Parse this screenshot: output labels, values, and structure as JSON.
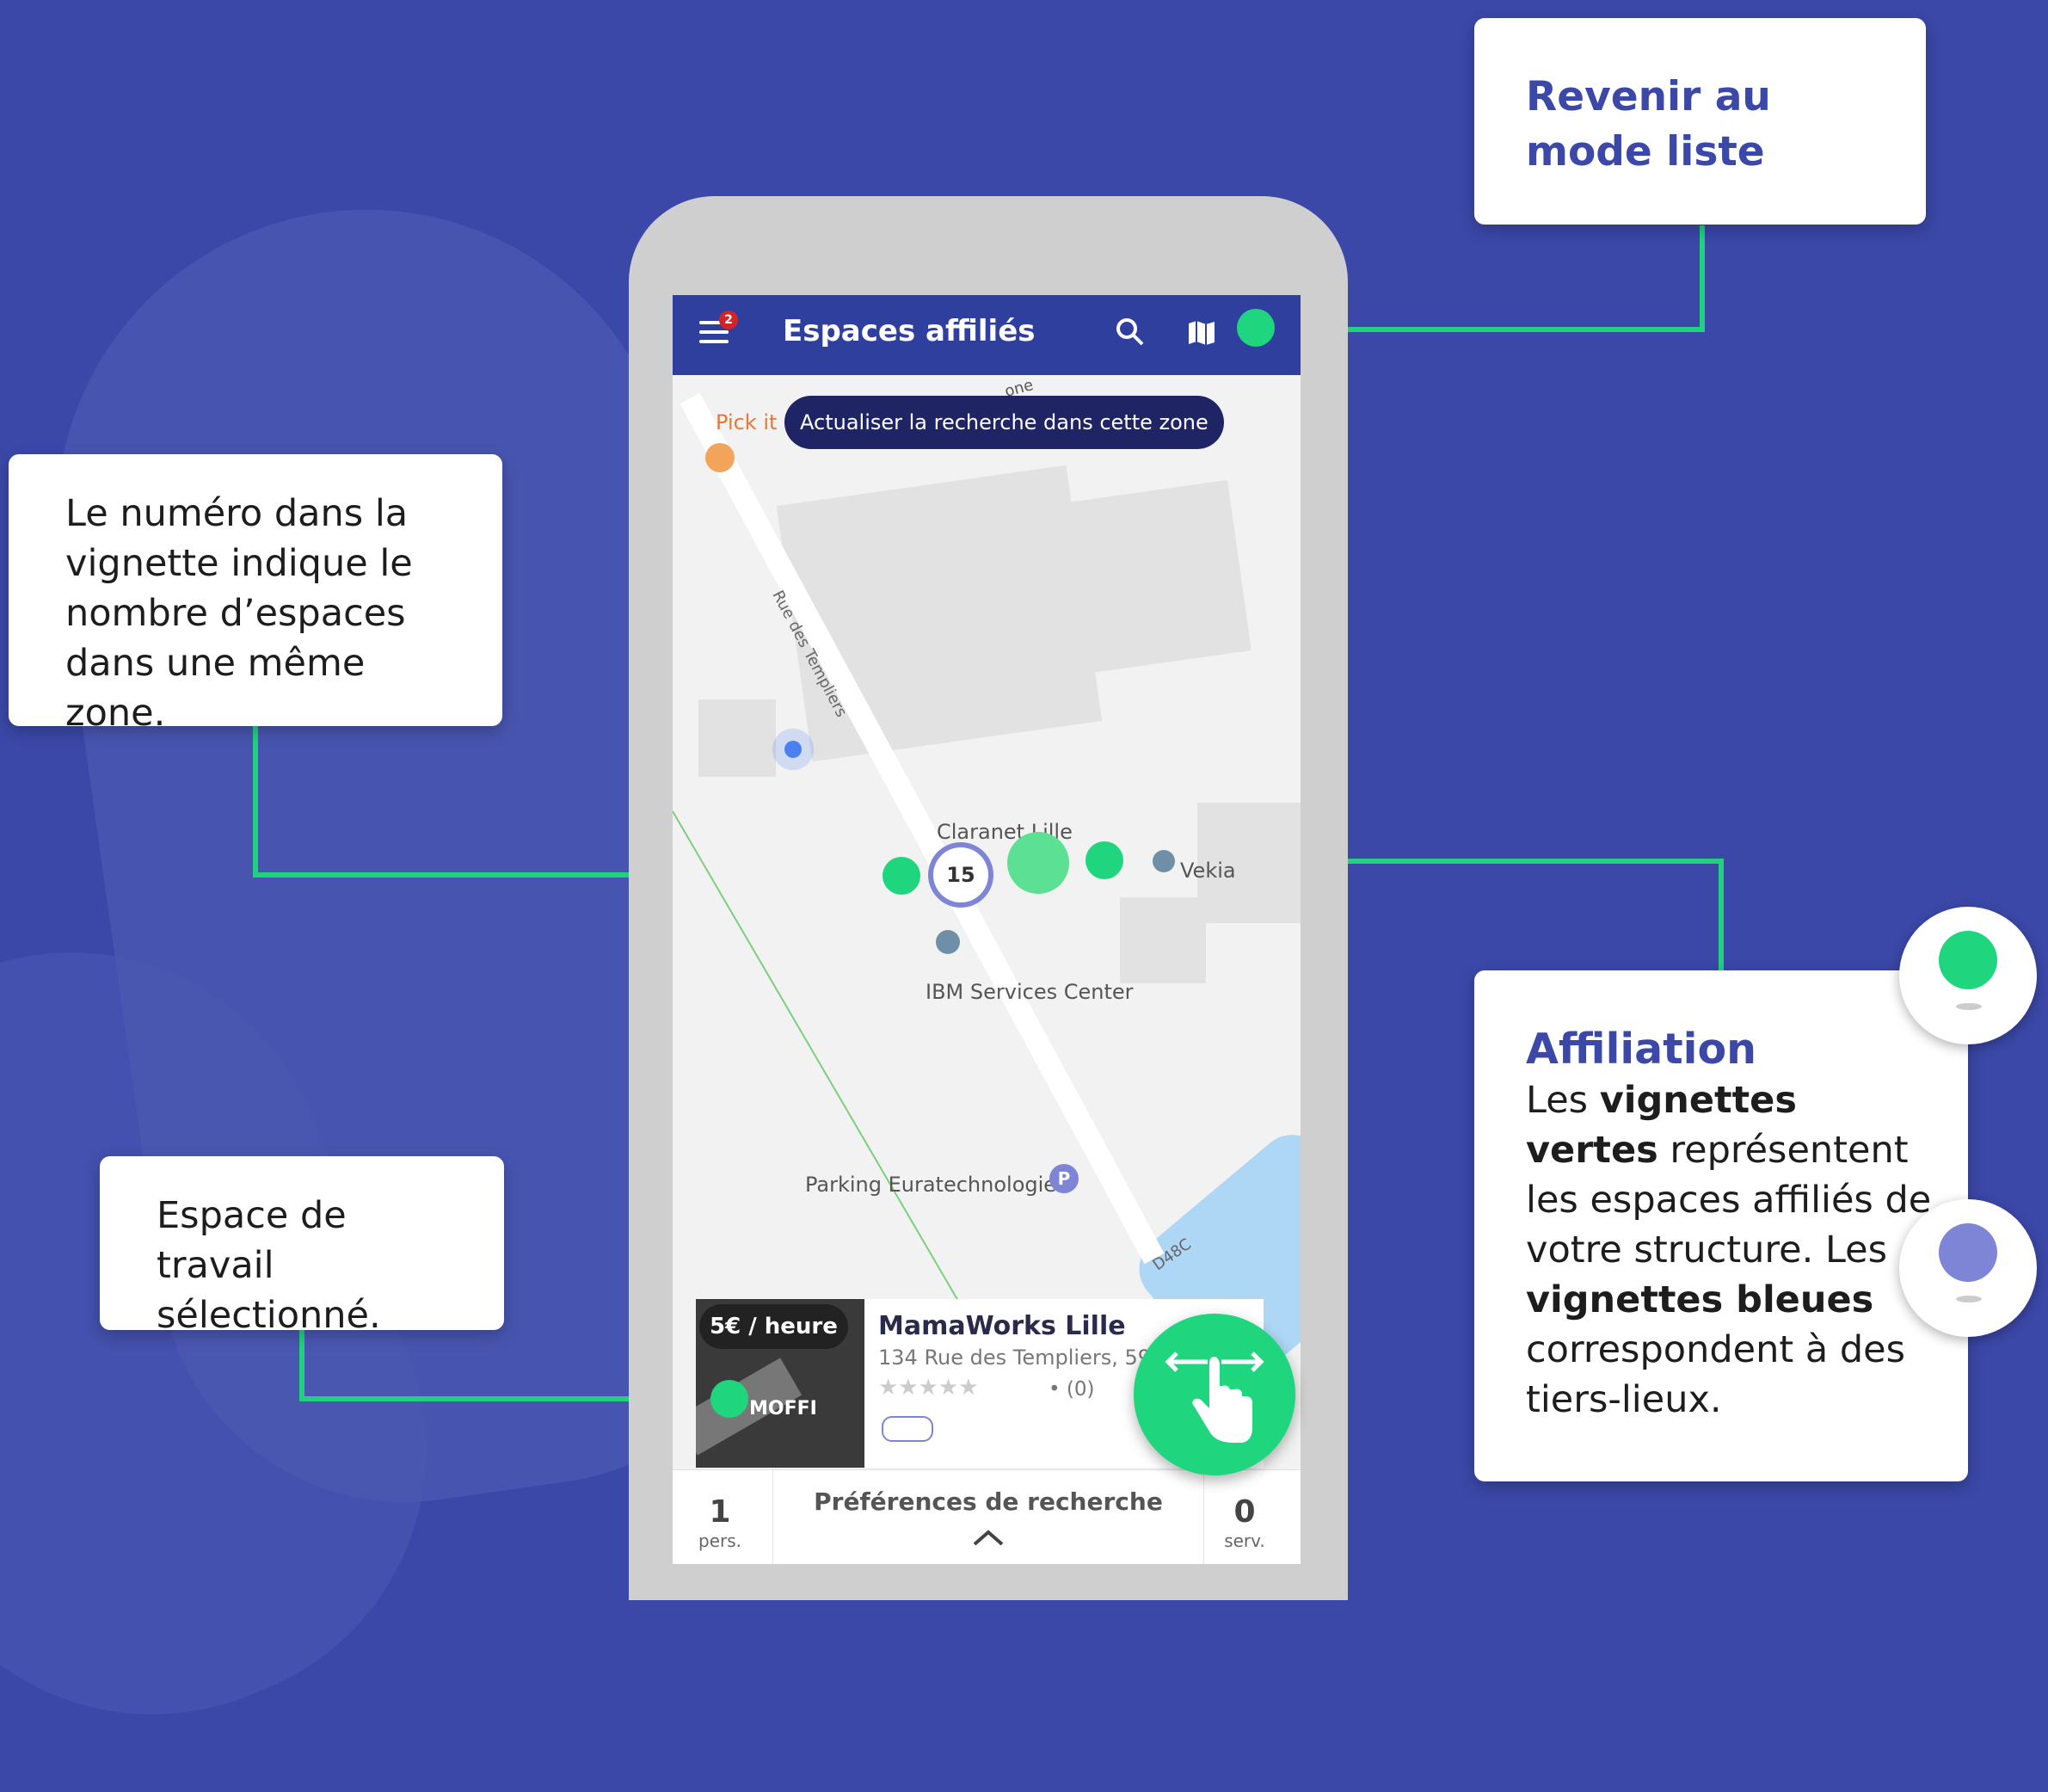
{
  "callouts": {
    "mode_liste": {
      "title": "Revenir au mode liste"
    },
    "numero": {
      "text": "Le numéro dans la vignette indique le nombre d’espaces dans une même zone."
    },
    "espace": {
      "text": "Espace de travail sélectionné."
    },
    "affiliation": {
      "title": "Affiliation",
      "p1": "Les ",
      "b1": "vignettes vertes",
      "p2": " représentent les espaces affiliés de votre structure. Les ",
      "b2": "vignettes bleues",
      "p3": " correspondent à des tiers-lieux."
    }
  },
  "app": {
    "title": "Espaces affiliés",
    "menu_badge": "2",
    "refresh_button": "Actualiser la recherche dans cette zone"
  },
  "map": {
    "labels": {
      "pick_it": "Pick it U",
      "street_templiers": "Rue des Templiers",
      "claranet": "Claranet Lille",
      "vekia": "Vekia",
      "ibm": "IBM Services Center",
      "parking": "Parking Euratechnologies",
      "d48c": "D48C",
      "zone": "one"
    },
    "cluster_count": "15"
  },
  "place": {
    "price": "5€ / heure",
    "logo": "MOFFI",
    "name": "MamaWorks Lille",
    "address": "134 Rue des Templiers, 590",
    "stars": "★★★★★",
    "reviews": "• (0)"
  },
  "prefs": {
    "persons_value": "1",
    "persons_label": "pers.",
    "title": "Préférences de recherche",
    "services_value": "0",
    "services_label": "serv."
  },
  "colors": {
    "background": "#3b48a8",
    "appbar": "#2f3f9e",
    "accent_green": "#1fd67f",
    "pin_blue": "#7e85d6"
  }
}
